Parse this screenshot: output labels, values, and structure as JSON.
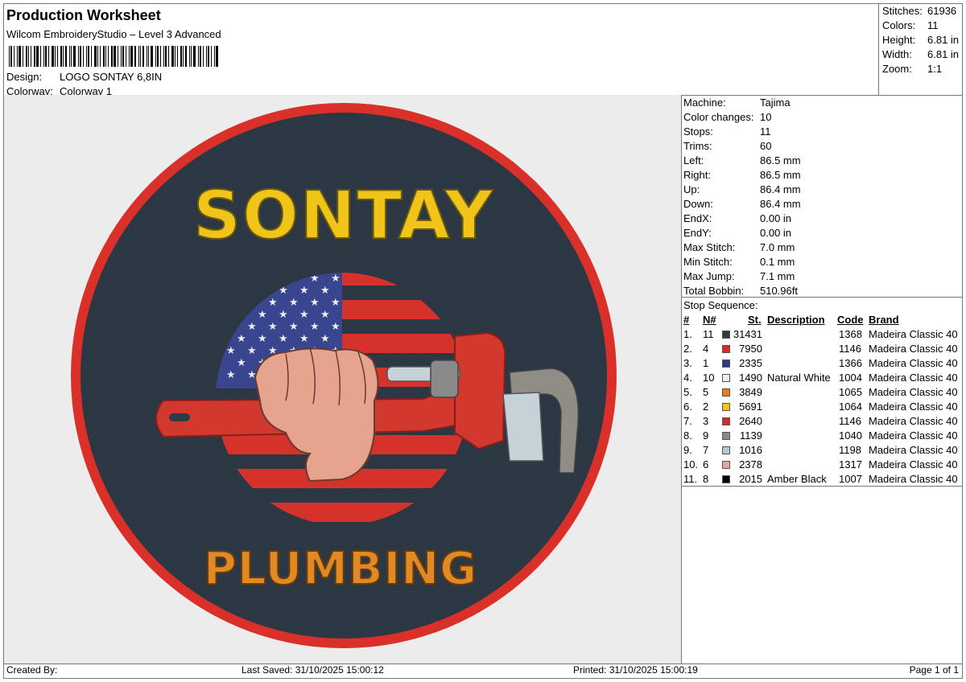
{
  "header": {
    "title": "Production Worksheet",
    "subtitle": "Wilcom EmbroideryStudio – Level 3 Advanced",
    "design_label": "Design:",
    "design_value": "LOGO SONTAY 6,8IN",
    "colorway_label": "Colorway:",
    "colorway_value": "Colorway 1"
  },
  "stats": [
    {
      "label": "Stitches:",
      "value": "61936"
    },
    {
      "label": "Colors:",
      "value": "11"
    },
    {
      "label": "Height:",
      "value": "6.81 in"
    },
    {
      "label": "Width:",
      "value": "6.81 in"
    },
    {
      "label": "Zoom:",
      "value": "1:1"
    }
  ],
  "machine_info": [
    {
      "label": "Machine:",
      "value": "Tajima"
    },
    {
      "label": "Color changes:",
      "value": "10"
    },
    {
      "label": "Stops:",
      "value": "11"
    },
    {
      "label": "Trims:",
      "value": "60"
    },
    {
      "label": "Left:",
      "value": "86.5 mm"
    },
    {
      "label": "Right:",
      "value": "86.5 mm"
    },
    {
      "label": "Up:",
      "value": "86.4 mm"
    },
    {
      "label": "Down:",
      "value": "86.4 mm"
    },
    {
      "label": "EndX:",
      "value": "0.00 in"
    },
    {
      "label": "EndY:",
      "value": "0.00 in"
    },
    {
      "label": "Max Stitch:",
      "value": "7.0 mm"
    },
    {
      "label": "Min Stitch:",
      "value": "0.1 mm"
    },
    {
      "label": "Max Jump:",
      "value": "7.1 mm"
    },
    {
      "label": "Total Bobbin:",
      "value": "510.96ft"
    }
  ],
  "stop_sequence": {
    "title": "Stop Sequence:",
    "headers": {
      "num": "#",
      "n": "N#",
      "st": "St.",
      "description": "Description",
      "code": "Code",
      "brand": "Brand"
    },
    "rows": [
      {
        "num": "1.",
        "n": "11",
        "color": "#2d3a48",
        "st": "31431",
        "description": "",
        "code": "1368",
        "brand": "Madeira Classic 40"
      },
      {
        "num": "2.",
        "n": "4",
        "color": "#d42a2a",
        "st": "7950",
        "description": "",
        "code": "1146",
        "brand": "Madeira Classic 40"
      },
      {
        "num": "3.",
        "n": "1",
        "color": "#2e3a86",
        "st": "2335",
        "description": "",
        "code": "1366",
        "brand": "Madeira Classic 40"
      },
      {
        "num": "4.",
        "n": "10",
        "color": "#eeeef2",
        "st": "1490",
        "description": "Natural White",
        "code": "1004",
        "brand": "Madeira Classic 40"
      },
      {
        "num": "5.",
        "n": "5",
        "color": "#e87a22",
        "st": "3849",
        "description": "",
        "code": "1065",
        "brand": "Madeira Classic 40"
      },
      {
        "num": "6.",
        "n": "2",
        "color": "#f2c418",
        "st": "5691",
        "description": "",
        "code": "1064",
        "brand": "Madeira Classic 40"
      },
      {
        "num": "7.",
        "n": "3",
        "color": "#d42a2a",
        "st": "2640",
        "description": "",
        "code": "1146",
        "brand": "Madeira Classic 40"
      },
      {
        "num": "8.",
        "n": "9",
        "color": "#8a8a8a",
        "st": "1139",
        "description": "",
        "code": "1040",
        "brand": "Madeira Classic 40"
      },
      {
        "num": "9.",
        "n": "7",
        "color": "#b8c6d0",
        "st": "1016",
        "description": "",
        "code": "1198",
        "brand": "Madeira Classic 40"
      },
      {
        "num": "10.",
        "n": "6",
        "color": "#e8a4a0",
        "st": "2378",
        "description": "",
        "code": "1317",
        "brand": "Madeira Classic 40"
      },
      {
        "num": "11.",
        "n": "8",
        "color": "#000000",
        "st": "2015",
        "description": "Amber Black",
        "code": "1007",
        "brand": "Madeira Classic 40"
      }
    ]
  },
  "preview": {
    "top_text": "SONTAY",
    "bottom_text": "PLUMBING"
  },
  "footer": {
    "created_by": "Created By:",
    "last_saved": "Last Saved: 31/10/2025 15:00:12",
    "printed": "Printed: 31/10/2025 15:00:19",
    "page": "Page 1 of 1"
  }
}
